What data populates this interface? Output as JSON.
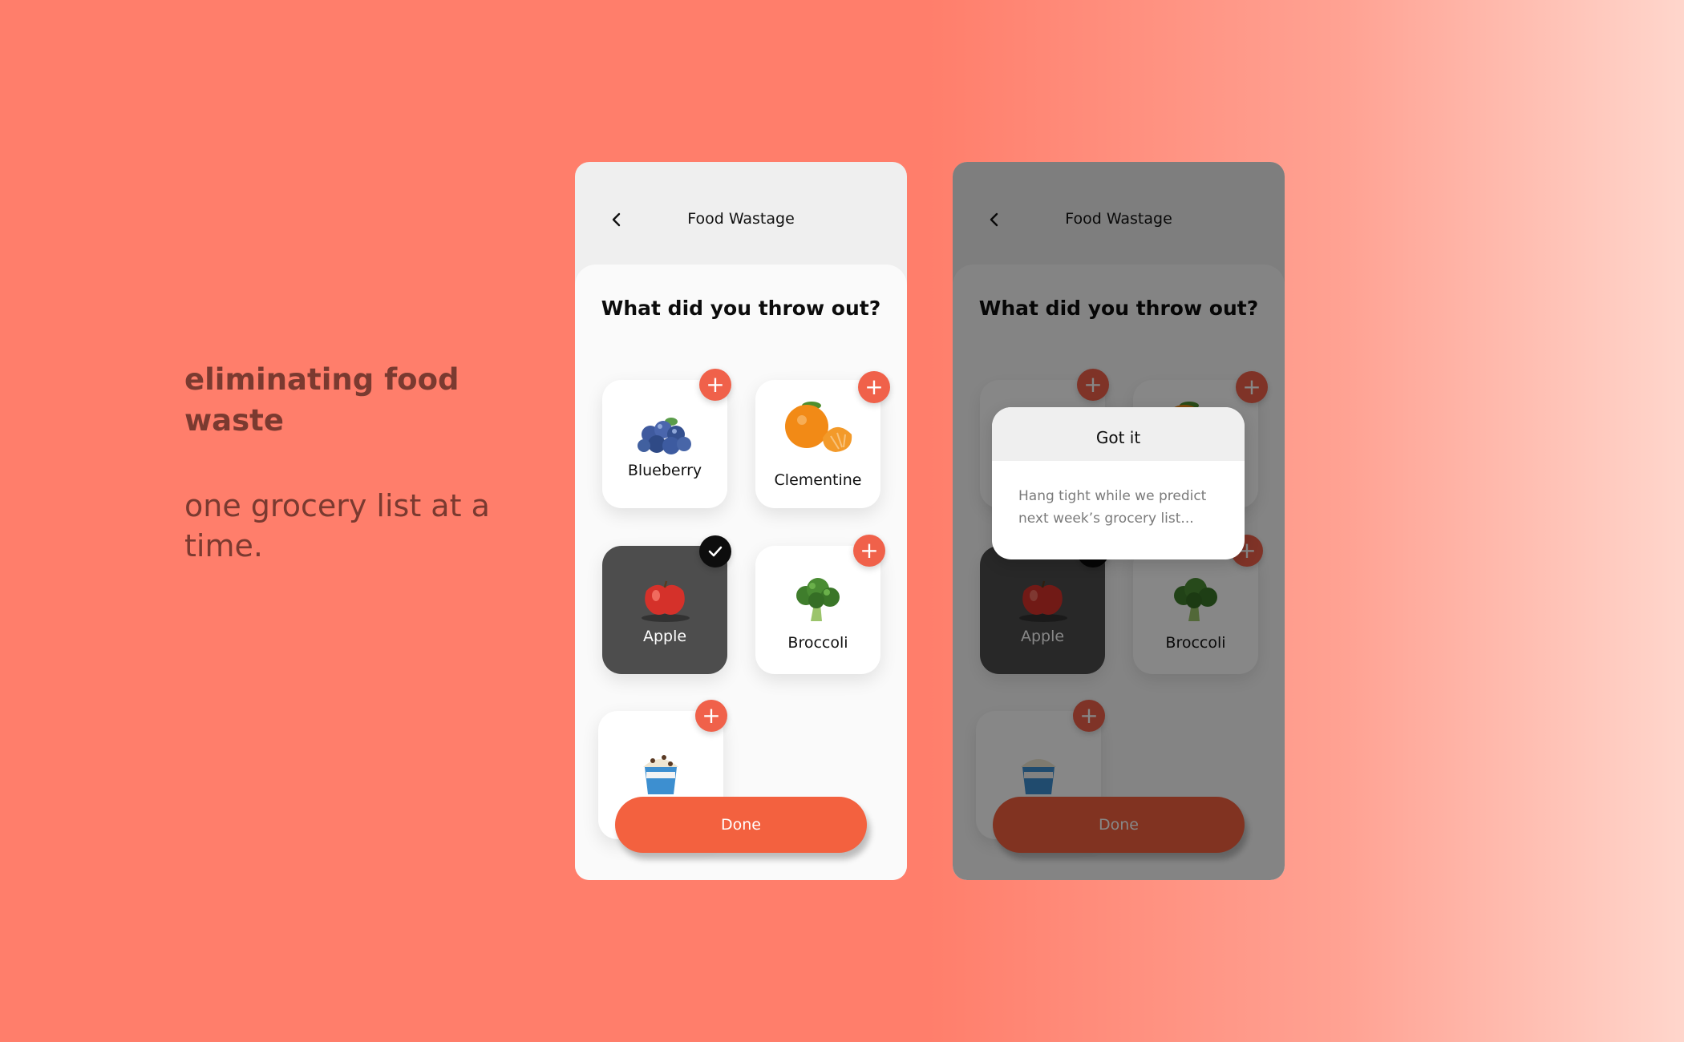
{
  "tagline": {
    "headline": "eliminating food waste",
    "subline": "one grocery list at a time."
  },
  "screens": {
    "header_title": "Food Wastage",
    "question": "What did you throw out?",
    "done_label": "Done",
    "back_icon": "chevron-left-icon"
  },
  "items": [
    {
      "label": "Blueberry",
      "selected": false,
      "icon": "blueberry-icon"
    },
    {
      "label": "Clementine",
      "selected": false,
      "icon": "clementine-icon"
    },
    {
      "label": "Apple",
      "selected": true,
      "icon": "apple-icon"
    },
    {
      "label": "Broccoli",
      "selected": false,
      "icon": "broccoli-icon"
    },
    {
      "label": "",
      "selected": false,
      "icon": "ice-cream-icon"
    }
  ],
  "dialog": {
    "title": "Got it",
    "message": "Hang tight while we predict next week’s grocery list..."
  },
  "colors": {
    "accent": "#f3613f",
    "badge": "#f0614a",
    "selected_card": "#4d4d4d",
    "background": "#ff7e6b"
  }
}
